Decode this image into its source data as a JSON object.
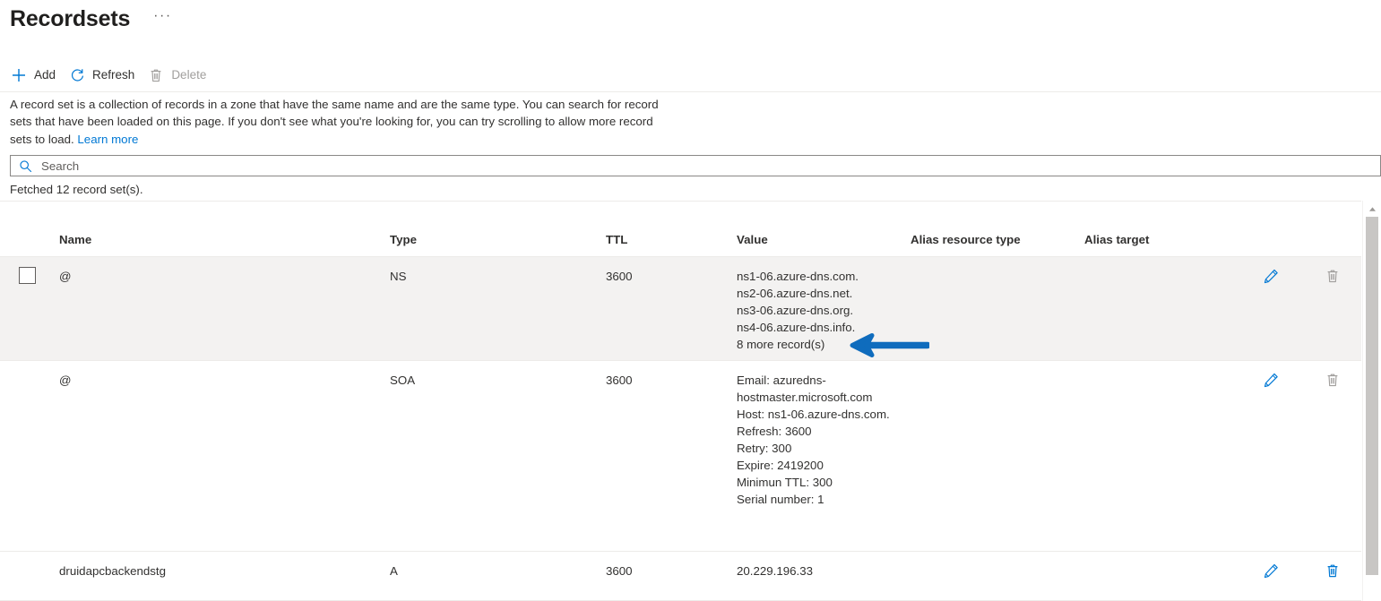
{
  "header": {
    "title": "Recordsets",
    "ellipsis_label": "···"
  },
  "toolbar": {
    "add_label": "Add",
    "refresh_label": "Refresh",
    "delete_label": "Delete",
    "add_icon": "plus-icon",
    "refresh_icon": "refresh-icon",
    "delete_icon": "trash-icon"
  },
  "description": {
    "text": "A record set is a collection of records in a zone that have the same name and are the same type. You can search for record sets that have been loaded on this page. If you don't see what you're looking for, you can try scrolling to allow more record sets to load. ",
    "link_label": "Learn more"
  },
  "search": {
    "placeholder": "Search",
    "value": "",
    "icon": "search-icon"
  },
  "status": {
    "fetched_text": "Fetched 12 record set(s)."
  },
  "grid": {
    "columns": [
      {
        "key": "name",
        "label": "Name"
      },
      {
        "key": "type",
        "label": "Type"
      },
      {
        "key": "ttl",
        "label": "TTL"
      },
      {
        "key": "value",
        "label": "Value"
      },
      {
        "key": "alias_resource_type",
        "label": "Alias resource type"
      },
      {
        "key": "alias_target",
        "label": "Alias target"
      }
    ],
    "rows": [
      {
        "name": "@",
        "type": "NS",
        "ttl": "3600",
        "value": "ns1-06.azure-dns.com.\nns2-06.azure-dns.net.\nns3-06.azure-dns.org.\nns4-06.azure-dns.info.\n8 more record(s)",
        "alias_resource_type": "",
        "alias_target": "",
        "edit_enabled": true,
        "delete_enabled": false,
        "checkbox_visible": true,
        "checked": false,
        "hovered": true
      },
      {
        "name": "@",
        "type": "SOA",
        "ttl": "3600",
        "value": "Email: azuredns-hostmaster.microsoft.com\nHost: ns1-06.azure-dns.com.\nRefresh: 3600\nRetry: 300\nExpire: 2419200\nMinimun TTL: 300\nSerial number: 1",
        "alias_resource_type": "",
        "alias_target": "",
        "edit_enabled": true,
        "delete_enabled": false,
        "checkbox_visible": false,
        "checked": false,
        "hovered": false
      },
      {
        "name": "druidapcbackendstg",
        "type": "A",
        "ttl": "3600",
        "value": "20.229.196.33",
        "alias_resource_type": "",
        "alias_target": "",
        "edit_enabled": true,
        "delete_enabled": true,
        "checkbox_visible": false,
        "checked": false,
        "hovered": false
      }
    ]
  },
  "annotation": {
    "arrow": "left-arrow-annotation",
    "color": "#0f6cbd"
  },
  "scrollbar": {
    "up_arrow": "scroll-up-arrow"
  },
  "colors": {
    "accent": "#0078d4",
    "annotation_blue": "#0f6cbd",
    "disabled_gray": "#a19f9d",
    "row_hover": "#f3f2f1",
    "divider": "#edebe9"
  }
}
